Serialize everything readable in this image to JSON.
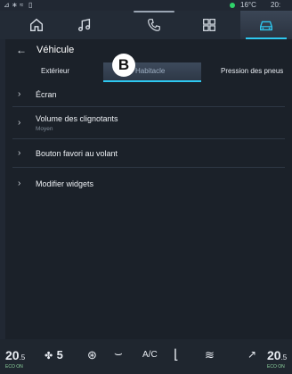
{
  "status": {
    "temperature": "16°C",
    "time": "20:"
  },
  "nav": {
    "items": [
      "home-icon",
      "music-icon",
      "phone-icon",
      "apps-icon",
      "vehicle-icon"
    ],
    "active": "vehicle-icon"
  },
  "header": {
    "title": "Véhicule"
  },
  "tabs": [
    {
      "label": "Extérieur"
    },
    {
      "label": "Habitacle"
    },
    {
      "label": "Pression des pneus"
    }
  ],
  "callout": "B",
  "list": [
    {
      "label": "Écran",
      "sub": ""
    },
    {
      "label": "Volume des clignotants",
      "sub": "Moyen"
    },
    {
      "label": "Bouton favori au volant",
      "sub": ""
    },
    {
      "label": "Modifier widgets",
      "sub": ""
    }
  ],
  "bottom": {
    "left_temp": "20",
    "left_temp_suffix": ".5",
    "left_eco": "ECO ON",
    "fan_level": "5",
    "ac": "A/C",
    "right_temp": "20",
    "right_temp_suffix": ".5",
    "right_eco": "ECO ON"
  },
  "colors": {
    "accent": "#2ec8f0",
    "status_green": "#2fd26a"
  }
}
